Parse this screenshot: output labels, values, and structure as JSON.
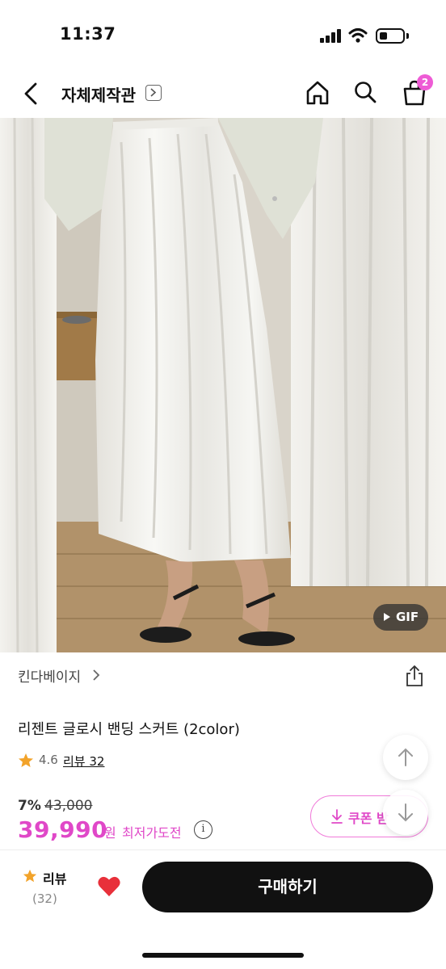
{
  "status_bar": {
    "time": "11:37"
  },
  "nav": {
    "title": "자체제작관",
    "cart_count": "2"
  },
  "media": {
    "badge_label": "GIF"
  },
  "product": {
    "brand": "킨다베이지",
    "name": "리젠트 글로시 밴딩 스커트 (2color)",
    "rating": "4.6",
    "review_link": "리뷰 32",
    "discount": "7%",
    "original_price": "43,000",
    "sale_price": "39,990",
    "currency": "원",
    "lowest_price_label": "최저가도전",
    "info_symbol": "i",
    "coupon_label": "쿠폰 받"
  },
  "bottom_bar": {
    "review_label": "리뷰",
    "review_count": "(32)",
    "buy_label": "구매하기"
  },
  "colors": {
    "accent": "#e048c8",
    "badge": "#ee5bd5",
    "heart": "#e8303a",
    "buy_button": "#111111"
  }
}
